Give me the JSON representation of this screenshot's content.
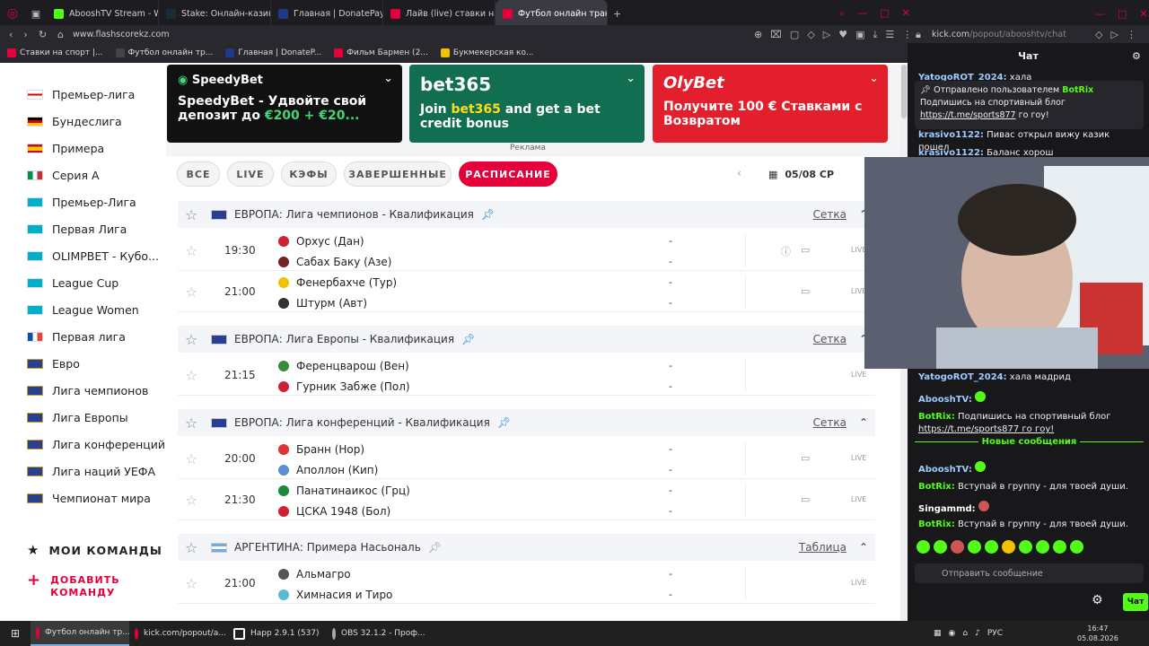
{
  "browser": {
    "tabs": [
      {
        "label": "AbooshTV Stream - Watch",
        "color": "#53fc18"
      },
      {
        "label": "Stake: Онлайн-казино и с",
        "color": "#1a2c38"
      },
      {
        "label": "Главная | DonatePay",
        "color": "#1e3a8a"
      },
      {
        "label": "Лайв (live) ставки на футб",
        "color": "#e4003a"
      },
      {
        "label": "Футбол онлайн трансляци",
        "color": "#e4003a"
      }
    ],
    "left_url": "www.flashscorekz.com",
    "right_url_host": "kick.com",
    "right_url_path": "/popout/abooshtv/chat",
    "bookmarks": [
      {
        "label": "Ставки на спорт |...",
        "color": "#e4003a"
      },
      {
        "label": "Футбол онлайн тр...",
        "color": "#444"
      },
      {
        "label": "Главная | DonateP...",
        "color": "#1e3a8a"
      },
      {
        "label": "Фильм Бармен (2...",
        "color": "#e4003a"
      },
      {
        "label": "Букмекерская ко...",
        "color": "#f2c200"
      }
    ]
  },
  "sidebar": {
    "items": [
      {
        "label": "Премьер-лига",
        "flag": "eng"
      },
      {
        "label": "Бундеслига",
        "flag": "de"
      },
      {
        "label": "Примера",
        "flag": "es"
      },
      {
        "label": "Серия А",
        "flag": "it"
      },
      {
        "label": "Премьер-Лига",
        "flag": "kz"
      },
      {
        "label": "Первая Лига",
        "flag": "kz"
      },
      {
        "label": "OLIMPBET - Кубо...",
        "flag": "kz"
      },
      {
        "label": "League Cup",
        "flag": "kz"
      },
      {
        "label": "League Women",
        "flag": "kz"
      },
      {
        "label": "Первая лига",
        "flag": "fr"
      },
      {
        "label": "Евро",
        "flag": "eu"
      },
      {
        "label": "Лига чемпионов",
        "flag": "eu"
      },
      {
        "label": "Лига Европы",
        "flag": "eu"
      },
      {
        "label": "Лига конференций",
        "flag": "eu"
      },
      {
        "label": "Лига наций УЕФА",
        "flag": "eu"
      },
      {
        "label": "Чемпионат мира",
        "flag": "eu"
      }
    ],
    "my_teams": "МОИ КОМАНДЫ",
    "add_team": "ДОБАВИТЬ КОМАНДУ"
  },
  "ads": [
    {
      "logo": "SpeedyBet",
      "text1": "SpeedyBet - Удвойте свой депозит до ",
      "hl": "€200 + €20...",
      "text2": "",
      "bg": "#111111",
      "hlcolor": "#42d67a"
    },
    {
      "logo": "bet365",
      "text1": "Join ",
      "hl": "bet365",
      "text2": " and get a bet credit bonus",
      "bg": "#126e51",
      "hlcolor": "#ffdf1b"
    },
    {
      "logo": "OlyBet",
      "text1": "Получите 100 € Ставками с Возвратом",
      "hl": "",
      "text2": "",
      "bg": "#e41f2d",
      "hlcolor": "#ffffff"
    }
  ],
  "ad_label": "Реклама",
  "filters": {
    "all": "ВСЕ",
    "live": "LIVE",
    "odds": "КЭФЫ",
    "finished": "ЗАВЕРШЕННЫЕ",
    "schedule": "РАСПИСАНИЕ"
  },
  "date": "05/08 СР",
  "leagues": [
    {
      "prefix": "ЕВРОПА:",
      "name": "Лига чемпионов - Квалификация",
      "link": "Сетка",
      "pinned": true,
      "matches": [
        {
          "time": "19:30",
          "home": "Орхус (Дан)",
          "away": "Сабах Баку (Азе)",
          "info": true
        },
        {
          "time": "21:00",
          "home": "Фенербахче (Тур)",
          "away": "Штурм (Авт)",
          "info": false
        }
      ]
    },
    {
      "prefix": "ЕВРОПА:",
      "name": "Лига Европы - Квалификация",
      "link": "Сетка",
      "pinned": true,
      "matches": [
        {
          "time": "21:15",
          "home": "Ференцварош (Вен)",
          "away": "Гурник Забже (Пол)",
          "info": false
        }
      ]
    },
    {
      "prefix": "ЕВРОПА:",
      "name": "Лига конференций - Квалификация",
      "link": "Сетка",
      "pinned": true,
      "matches": [
        {
          "time": "20:00",
          "home": "Бранн (Нор)",
          "away": "Аполлон (Кип)",
          "info": false
        },
        {
          "time": "21:30",
          "home": "Панатинаикос (Грц)",
          "away": "ЦСКА 1948 (Бол)",
          "info": false
        }
      ]
    },
    {
      "prefix": "АРГЕНТИНА:",
      "name": "Примера Насьональ",
      "link": "Таблица",
      "pinned": false,
      "matches": [
        {
          "time": "21:00",
          "home": "Альмагро",
          "away": "Химнасия и Тиро",
          "info": false
        }
      ]
    }
  ],
  "score_placeholder": "-",
  "live_label": "LIVE",
  "chat": {
    "header": "Чат",
    "top_msgs": [
      {
        "user": "YatogoROT_2024:",
        "text": "хала"
      },
      {
        "user": "krasivo1122:",
        "text": "Пивас открыл вижу казик пошел"
      },
      {
        "user": "krasivo1122:",
        "text": "Баланс хорош"
      }
    ],
    "pinned_by": "Отправлено пользователем",
    "pinned_user": "BotRix",
    "pinned_text": "Подпишись на спортивный блог",
    "pinned_link": "https://t.me/sports877",
    "pinned_tail": " го гоу!",
    "msgs": [
      {
        "user": "YatogoROT_2024:",
        "text": "хала мадрид",
        "color": "#9ecbff"
      },
      {
        "user": "AbooshTV:",
        "text": "",
        "color": "#9ecbff"
      },
      {
        "user": "BotRix:",
        "text": "Подпишись на спортивный блог",
        "color": "#53fc18"
      },
      {
        "user": "",
        "text": "https://t.me/sports877 го гоу!",
        "color": "#efeff1"
      }
    ],
    "new_messages": "Новые сообщения",
    "new_msgs": [
      {
        "user": "AbooshTV:",
        "text": "",
        "color": "#9ecbff"
      },
      {
        "user": "BotRix:",
        "text": "Вступай в группу - для твоей души.",
        "color": "#53fc18"
      },
      {
        "user": "Singammd:",
        "text": "",
        "color": "#ffffff"
      },
      {
        "user": "BotRix:",
        "text": "Вступай в группу - для твоей души.",
        "color": "#53fc18"
      }
    ],
    "input_placeholder": "Отправить сообщение",
    "send_label": "Чат"
  },
  "taskbar": {
    "items": [
      "Футбол онлайн тр...",
      "kick.com/popout/a...",
      "Happ 2.9.1 (537)",
      "OBS 32.1.2 - Проф..."
    ],
    "lang": "РУС",
    "time": "16:47",
    "date": "05.08.2026"
  }
}
